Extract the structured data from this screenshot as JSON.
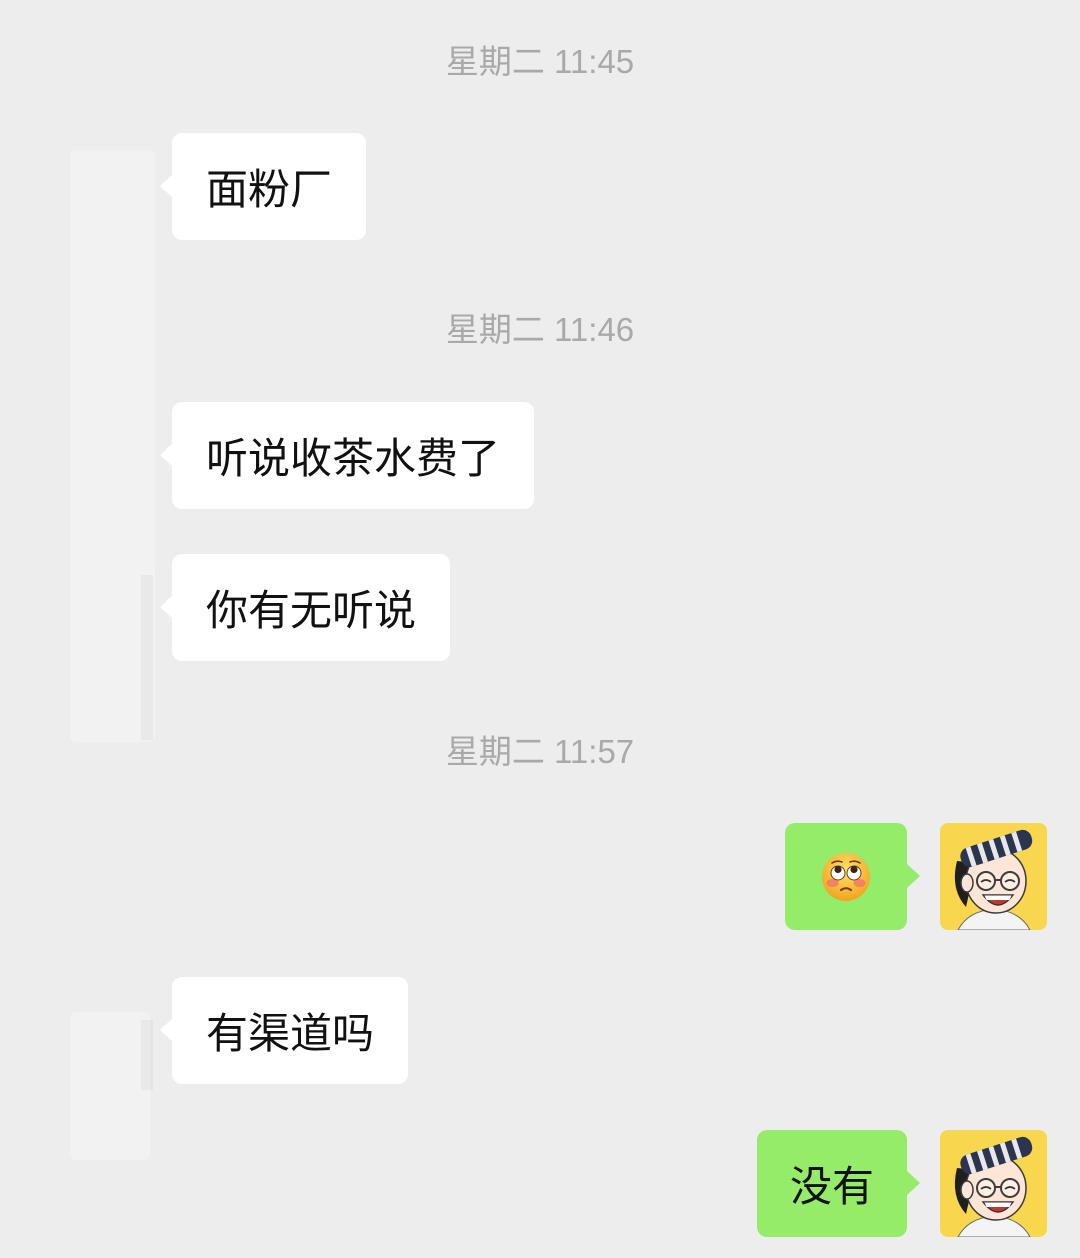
{
  "colors": {
    "background": "#ededed",
    "received_bubble": "#ffffff",
    "sent_bubble": "#95ec69",
    "timestamp": "#a9a9a9",
    "message_text": "#111111"
  },
  "chat": {
    "timestamps": [
      "星期二 11:45",
      "星期二 11:46",
      "星期二 11:57"
    ],
    "messages": [
      {
        "from_self": false,
        "text": "面粉厂"
      },
      {
        "from_self": false,
        "text": "听说收茶水费了"
      },
      {
        "from_self": false,
        "text": "你有无听说"
      },
      {
        "from_self": true,
        "emoji_icon": "flushed-face-icon"
      },
      {
        "from_self": false,
        "text": "有渠道吗"
      },
      {
        "from_self": true,
        "text": "没有"
      }
    ],
    "self_avatar_icon": "cartoon-avatar-icon",
    "other_avatar_icon": "redacted-avatar"
  }
}
